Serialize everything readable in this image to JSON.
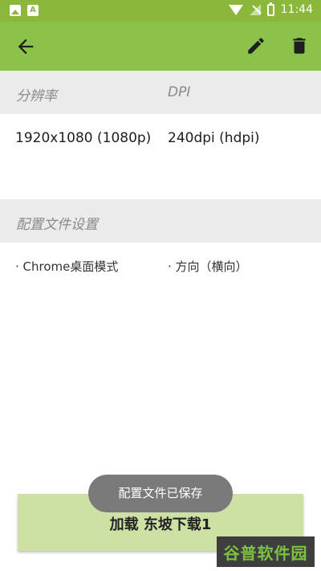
{
  "status_bar": {
    "time": "11:44",
    "left_icons": [
      "image-icon",
      "font-icon"
    ],
    "right_icons": [
      "wifi-icon",
      "no-signal-icon",
      "battery-icon"
    ]
  },
  "appbar": {
    "color": "#8bc34a",
    "icons": [
      "back-arrow-icon",
      "edit-pencil-icon",
      "delete-trash-icon"
    ]
  },
  "section_display": {
    "resolution_label": "分辨率",
    "dpi_label": "DPI",
    "resolution_value": "1920x1080 (1080p)",
    "dpi_value": "240dpi (hdpi)"
  },
  "section_profile": {
    "header": "配置文件设置",
    "options": [
      "· Chrome桌面模式",
      "· 方向（横向）"
    ]
  },
  "toast": "配置文件已保存",
  "load_button": "加载 东坡下载1",
  "watermark": "谷普软件园"
}
